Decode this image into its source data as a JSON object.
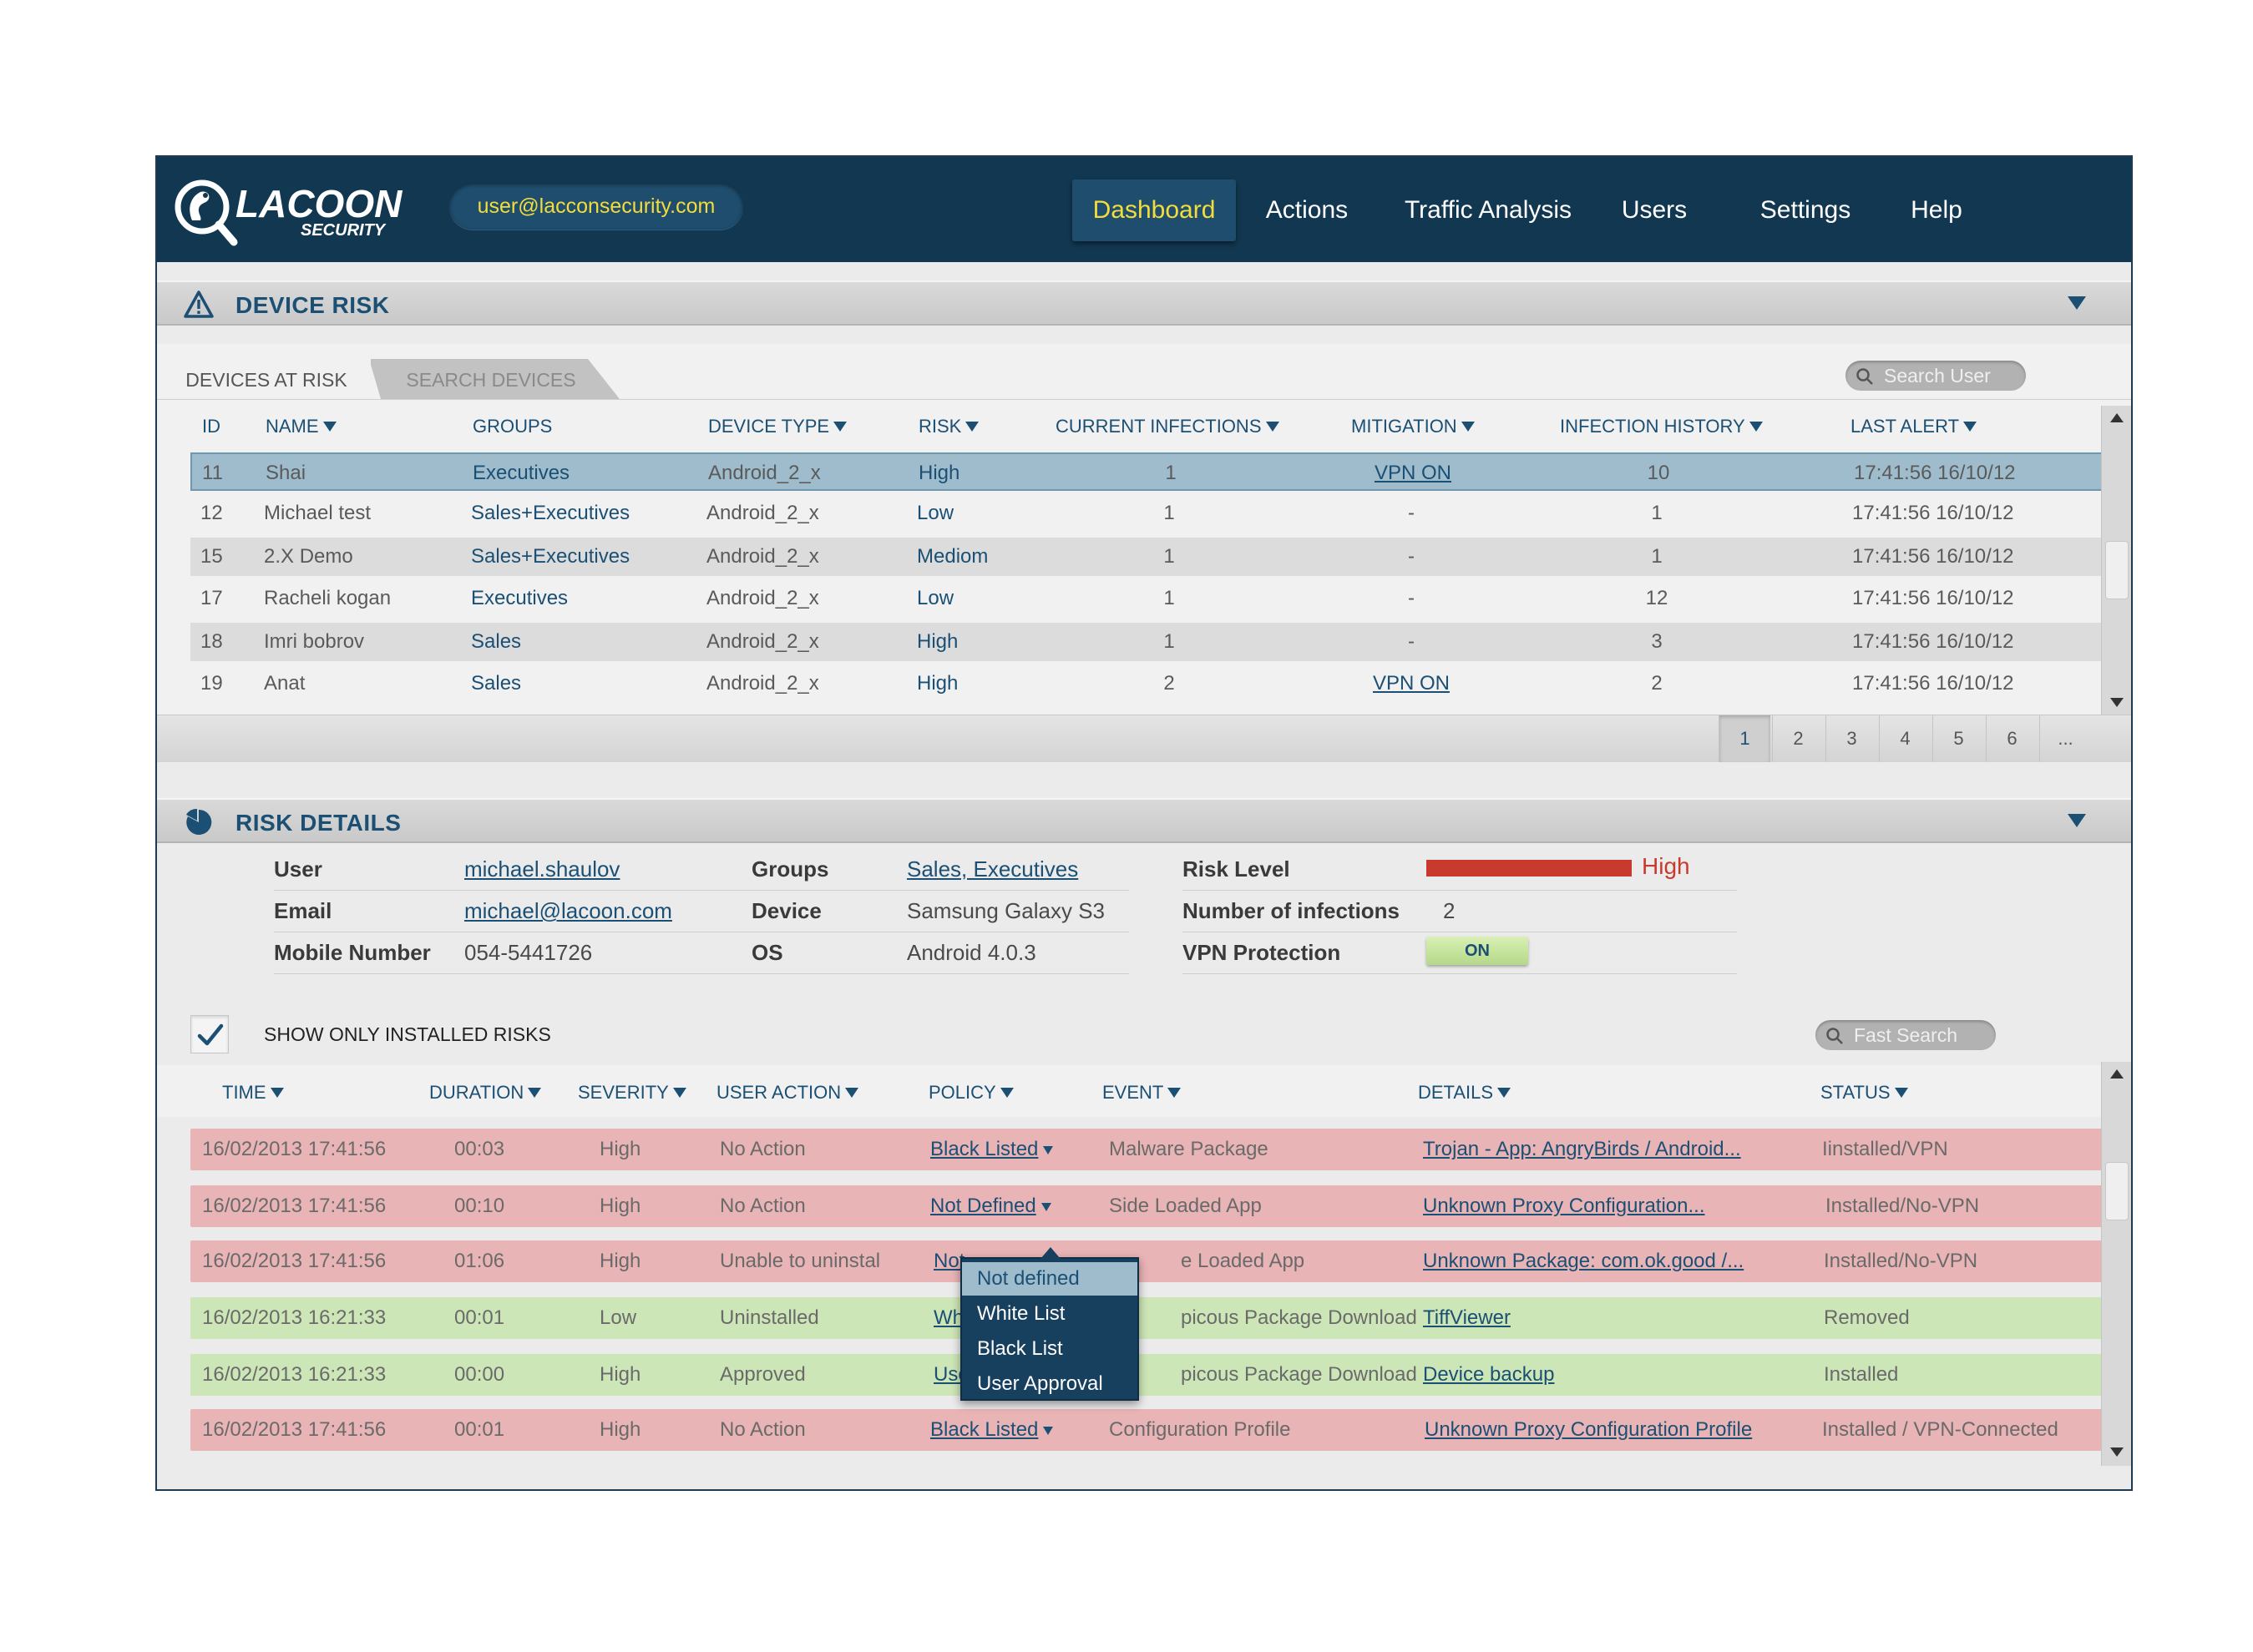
{
  "header": {
    "brand_name": "LACOON",
    "brand_sub": "SECURITY",
    "user_email": "user@lacconsecurity.com",
    "nav": [
      {
        "label": "Dashboard",
        "active": true
      },
      {
        "label": "Actions"
      },
      {
        "label": "Traffic Analysis"
      },
      {
        "label": "Users"
      },
      {
        "label": "Settings"
      },
      {
        "label": "Help"
      }
    ]
  },
  "device_risk": {
    "title": "DEVICE RISK",
    "tabs": [
      "DEVICES AT RISK",
      "SEARCH DEVICES"
    ],
    "search_placeholder": "Search User",
    "columns": [
      "ID",
      "NAME",
      "GROUPS",
      "DEVICE TYPE",
      "RISK",
      "CURRENT INFECTIONS",
      "MITIGATION",
      "INFECTION HISTORY",
      "LAST ALERT"
    ],
    "rows": [
      {
        "id": "11",
        "name": "Shai",
        "groups": "Executives",
        "device": "Android_2_x",
        "risk": "High",
        "infections": "1",
        "mitigation": "VPN ON",
        "history": "10",
        "alert": "17:41:56 16/10/12"
      },
      {
        "id": "12",
        "name": "Michael test",
        "groups": "Sales+Executives",
        "device": "Android_2_x",
        "risk": "Low",
        "infections": "1",
        "mitigation": "-",
        "history": "1",
        "alert": "17:41:56 16/10/12"
      },
      {
        "id": "15",
        "name": "2.X Demo",
        "groups": "Sales+Executives",
        "device": "Android_2_x",
        "risk": "Mediom",
        "infections": "1",
        "mitigation": "-",
        "history": "1",
        "alert": "17:41:56 16/10/12"
      },
      {
        "id": "17",
        "name": "Racheli kogan",
        "groups": "Executives",
        "device": "Android_2_x",
        "risk": "Low",
        "infections": "1",
        "mitigation": "-",
        "history": "12",
        "alert": "17:41:56 16/10/12"
      },
      {
        "id": "18",
        "name": "Imri bobrov",
        "groups": "Sales",
        "device": "Android_2_x",
        "risk": "High",
        "infections": "1",
        "mitigation": "-",
        "history": "3",
        "alert": "17:41:56 16/10/12"
      },
      {
        "id": "19",
        "name": "Anat",
        "groups": "Sales",
        "device": "Android_2_x",
        "risk": "High",
        "infections": "2",
        "mitigation": "VPN ON",
        "history": "2",
        "alert": "17:41:56 16/10/12"
      }
    ],
    "pages": [
      "1",
      "2",
      "3",
      "4",
      "5",
      "6",
      "..."
    ]
  },
  "risk_details": {
    "title": "RISK DETAILS",
    "user_label": "User",
    "user_value": "michael.shaulov",
    "email_label": "Email",
    "email_value": "michael@lacoon.com",
    "mobile_label": "Mobile  Number",
    "mobile_value": "054-5441726",
    "groups_label": "Groups",
    "groups_value": "Sales, Executives",
    "device_label": "Device",
    "device_value": "Samsung Galaxy S3",
    "os_label": "OS",
    "os_value": "Android 4.0.3",
    "risk_level_label": "Risk Level",
    "risk_level_value": "High",
    "infections_label": "Number of infections",
    "infections_value": "2",
    "vpn_label": "VPN Protection",
    "vpn_value": "ON",
    "show_installed_label": "SHOW ONLY INSTALLED RISKS",
    "fast_search_placeholder": "Fast Search",
    "columns": [
      "TIME",
      "DURATION",
      "SEVERITY",
      "USER ACTION",
      "POLICY",
      "EVENT",
      "DETAILS",
      "STATUS"
    ],
    "events": [
      {
        "time": "16/02/2013  17:41:56",
        "duration": "00:03",
        "severity": "High",
        "action": "No Action",
        "policy": "Black Listed",
        "event": "Malware Package",
        "details": "Trojan - App: AngryBirds / Android...",
        "status": "Iinstalled/VPN",
        "tone": "red"
      },
      {
        "time": "16/02/2013  17:41:56",
        "duration": "00:10",
        "severity": "High",
        "action": "No Action",
        "policy": "Not Defined",
        "event": "Side Loaded App",
        "details": "Unknown Proxy Configuration...",
        "status": "Installed/No-VPN",
        "tone": "red"
      },
      {
        "time": "16/02/2013  17:41:56",
        "duration": "01:06",
        "severity": "High",
        "action": "Unable to uninstal",
        "policy": "Not",
        "event": "e Loaded App",
        "details": "Unknown Package: com.ok.good /...",
        "status": "Installed/No-VPN",
        "tone": "red"
      },
      {
        "time": "16/02/2013  16:21:33",
        "duration": "00:01",
        "severity": "Low",
        "action": "Uninstalled",
        "policy": "Whi",
        "event": "picous Package Download",
        "details": "TiffViewer",
        "status": "Removed",
        "tone": "green"
      },
      {
        "time": "16/02/2013  16:21:33",
        "duration": "00:00",
        "severity": "High",
        "action": "Approved",
        "policy": "User",
        "event": "picous Package Download",
        "details": "Device backup",
        "status": "Installed",
        "tone": "green"
      },
      {
        "time": "16/02/2013  17:41:56",
        "duration": "00:01",
        "severity": "High",
        "action": "No Action",
        "policy": "Black Listed",
        "event": "Configuration Profile",
        "details": "Unknown Proxy Configuration Profile",
        "status": "Installed / VPN-Connected",
        "tone": "red"
      }
    ],
    "policy_dropdown": [
      "Not defined",
      "White List",
      "Black List",
      "User Approval"
    ]
  },
  "colors": {
    "navbar": "#123750",
    "accent_yellow": "#f4dc3a",
    "text_blue": "#1b4f74",
    "risk_red": "#c83a2e",
    "row_red": "#e9b4b6",
    "row_green": "#cde6b7",
    "selected_row": "#9fbccd"
  }
}
